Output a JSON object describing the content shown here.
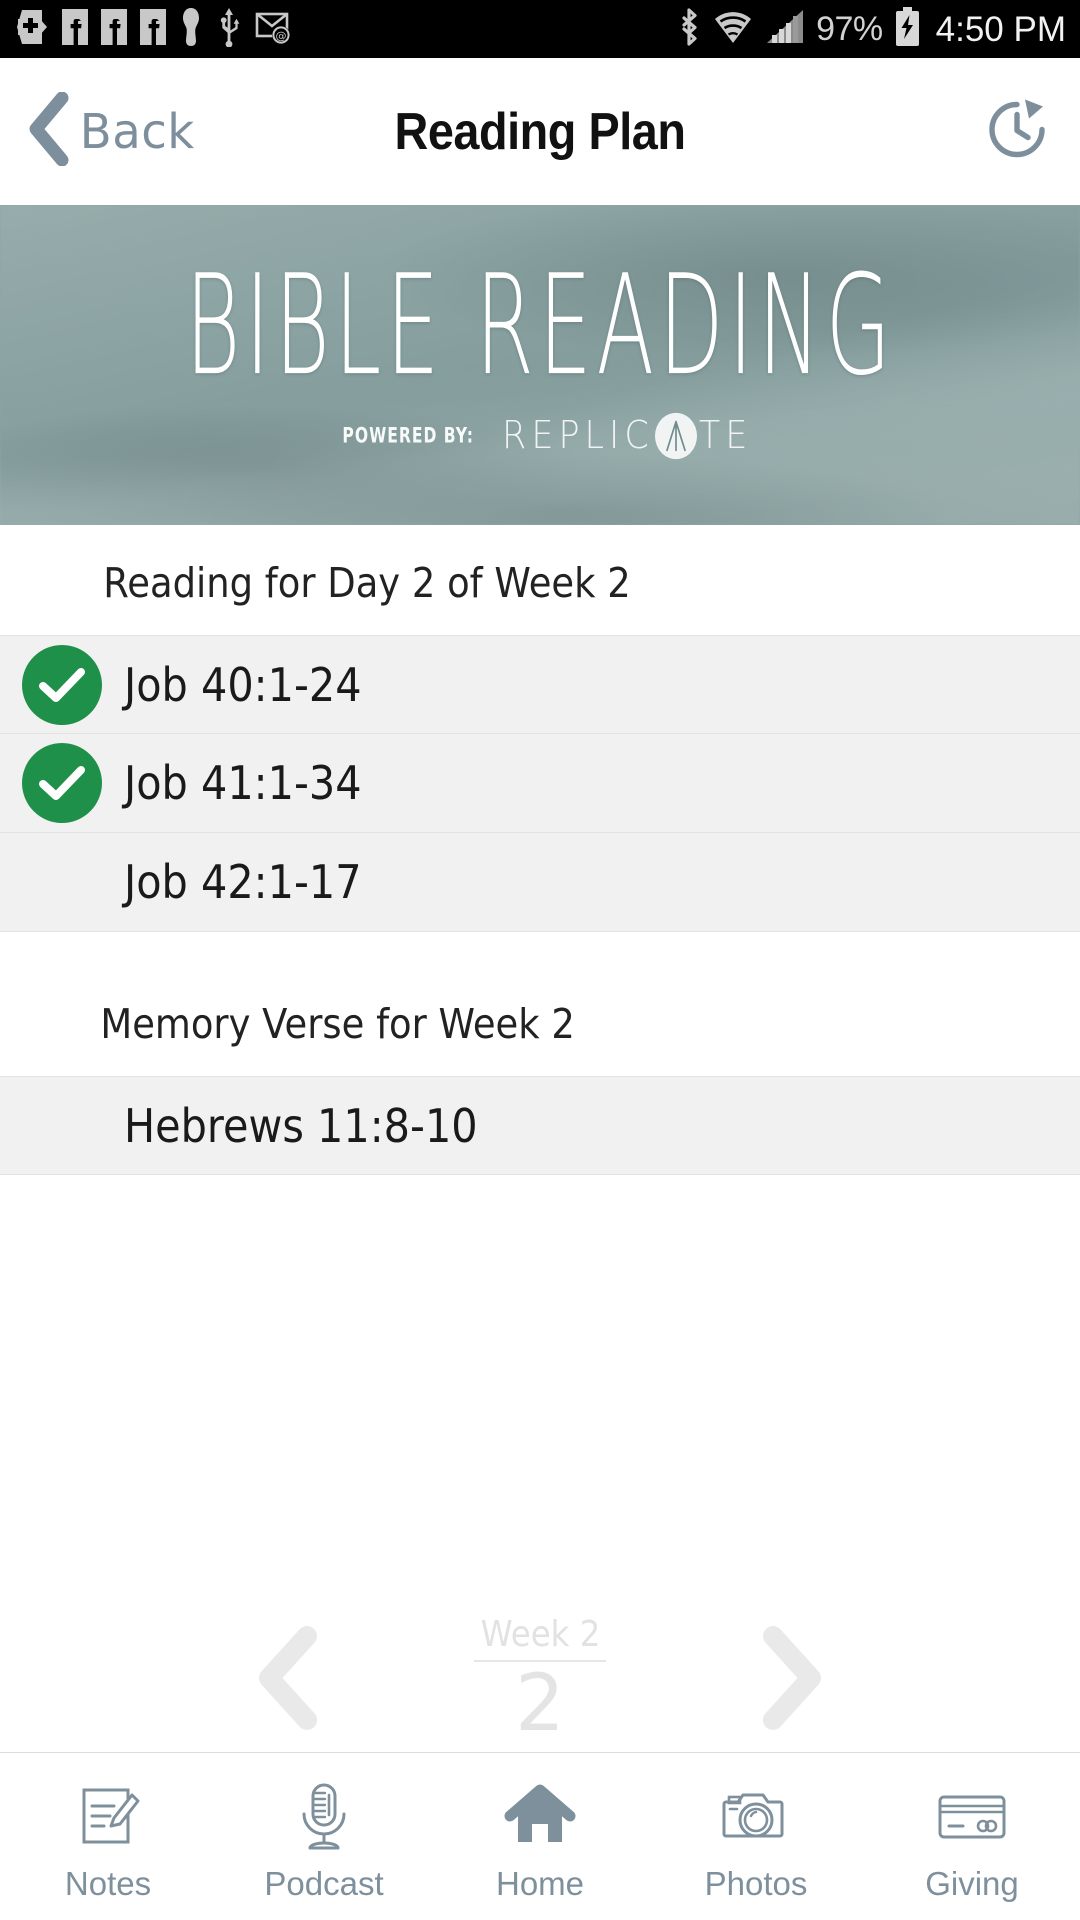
{
  "status_bar": {
    "icons": [
      "shield-plus-icon",
      "facebook-icon",
      "facebook-icon",
      "facebook-icon",
      "keyhole-icon",
      "usb-icon",
      "email-icon",
      "bluetooth-icon",
      "wifi-icon",
      "cell-signal-icon"
    ],
    "battery_percent": "97%",
    "battery_state": "charging",
    "time": "4:50 PM"
  },
  "nav": {
    "back_label": "Back",
    "title": "Reading Plan",
    "action_icon": "history-reset-icon"
  },
  "banner": {
    "title": "BIBLE READING",
    "powered_by": "POWERED BY:",
    "brand_pre": "REPLIC",
    "brand_post": "TE",
    "brand_full": "REPLICATE",
    "overlay_color": "#8fa6a6"
  },
  "reading": {
    "section_title": "Reading for Day 2 of Week 2",
    "items": [
      {
        "label": "Job 40:1-24",
        "completed": true
      },
      {
        "label": "Job 41:1-34",
        "completed": true
      },
      {
        "label": "Job 42:1-17",
        "completed": false
      }
    ]
  },
  "memory_verse": {
    "section_title": "Memory Verse for Week 2",
    "items": [
      {
        "label": "Hebrews 11:8-10",
        "completed": false
      }
    ]
  },
  "week_nav": {
    "prev_icon": "chevron-left-icon",
    "next_icon": "chevron-right-icon",
    "label": "Week 2",
    "number": "2"
  },
  "tabs": [
    {
      "label": "Notes",
      "icon": "notes-icon",
      "active": false
    },
    {
      "label": "Podcast",
      "icon": "podcast-icon",
      "active": false
    },
    {
      "label": "Home",
      "icon": "home-icon",
      "active": true
    },
    {
      "label": "Photos",
      "icon": "photos-icon",
      "active": false
    },
    {
      "label": "Giving",
      "icon": "giving-icon",
      "active": false
    }
  ],
  "colors": {
    "check_green": "#1e9049",
    "accent_slate": "#7f909d",
    "banner_teal": "#8fa6a6",
    "row_bg": "#f1f1f1"
  }
}
